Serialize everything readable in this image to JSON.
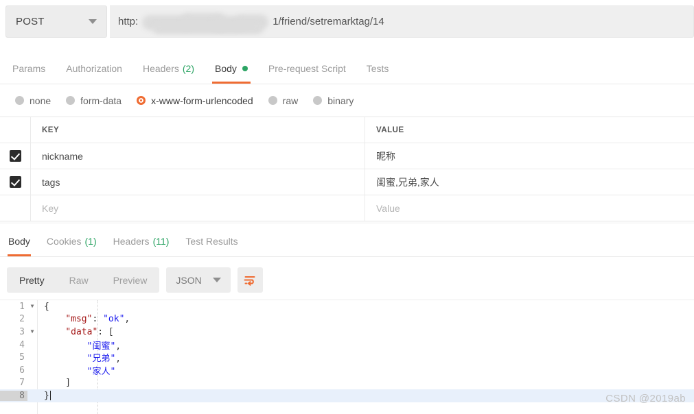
{
  "request": {
    "method": "POST",
    "method_caret": "chevron-down-icon",
    "url_scheme": "http:",
    "url_redacted": true,
    "url_tail": "1/friend/setremarktag/14",
    "tabs": [
      {
        "label": "Params",
        "count": null,
        "active": false,
        "dot": false
      },
      {
        "label": "Authorization",
        "count": null,
        "active": false,
        "dot": false
      },
      {
        "label": "Headers",
        "count": "(2)",
        "active": false,
        "dot": false
      },
      {
        "label": "Body",
        "count": null,
        "active": true,
        "dot": true
      },
      {
        "label": "Pre-request Script",
        "count": null,
        "active": false,
        "dot": false
      },
      {
        "label": "Tests",
        "count": null,
        "active": false,
        "dot": false
      }
    ],
    "body_types": [
      {
        "label": "none",
        "selected": false
      },
      {
        "label": "form-data",
        "selected": false
      },
      {
        "label": "x-www-form-urlencoded",
        "selected": true
      },
      {
        "label": "raw",
        "selected": false
      },
      {
        "label": "binary",
        "selected": false
      }
    ],
    "table": {
      "columns": [
        "KEY",
        "VALUE"
      ],
      "rows": [
        {
          "checked": true,
          "key": "nickname",
          "value": "昵称",
          "placeholder": false
        },
        {
          "checked": true,
          "key": "tags",
          "value": "闺蜜,兄弟,家人",
          "placeholder": false
        },
        {
          "checked": false,
          "key": "Key",
          "value": "Value",
          "placeholder": true
        }
      ]
    }
  },
  "response": {
    "tabs": [
      {
        "label": "Body",
        "count": null,
        "active": true
      },
      {
        "label": "Cookies",
        "count": "(1)",
        "active": false
      },
      {
        "label": "Headers",
        "count": "(11)",
        "active": false
      },
      {
        "label": "Test Results",
        "count": null,
        "active": false
      }
    ],
    "view_modes": [
      {
        "label": "Pretty",
        "active": true
      },
      {
        "label": "Raw",
        "active": false
      },
      {
        "label": "Preview",
        "active": false
      }
    ],
    "format": "JSON",
    "wrap_icon": "word-wrap-icon",
    "code_lines": [
      {
        "num": "1",
        "fold": true,
        "active": false,
        "tokens": [
          {
            "t": "punc",
            "v": "{"
          }
        ]
      },
      {
        "num": "2",
        "fold": false,
        "active": false,
        "tokens": [
          {
            "t": "punc",
            "v": "    "
          },
          {
            "t": "key",
            "v": "\"msg\""
          },
          {
            "t": "punc",
            "v": ": "
          },
          {
            "t": "str",
            "v": "\"ok\""
          },
          {
            "t": "punc",
            "v": ","
          }
        ]
      },
      {
        "num": "3",
        "fold": true,
        "active": false,
        "tokens": [
          {
            "t": "punc",
            "v": "    "
          },
          {
            "t": "key",
            "v": "\"data\""
          },
          {
            "t": "punc",
            "v": ": ["
          }
        ]
      },
      {
        "num": "4",
        "fold": false,
        "active": false,
        "tokens": [
          {
            "t": "punc",
            "v": "        "
          },
          {
            "t": "str",
            "v": "\"闺蜜\""
          },
          {
            "t": "punc",
            "v": ","
          }
        ]
      },
      {
        "num": "5",
        "fold": false,
        "active": false,
        "tokens": [
          {
            "t": "punc",
            "v": "        "
          },
          {
            "t": "str",
            "v": "\"兄弟\""
          },
          {
            "t": "punc",
            "v": ","
          }
        ]
      },
      {
        "num": "6",
        "fold": false,
        "active": false,
        "tokens": [
          {
            "t": "punc",
            "v": "        "
          },
          {
            "t": "str",
            "v": "\"家人\""
          }
        ]
      },
      {
        "num": "7",
        "fold": false,
        "active": false,
        "tokens": [
          {
            "t": "punc",
            "v": "    ]"
          }
        ]
      },
      {
        "num": "8",
        "fold": false,
        "active": true,
        "tokens": [
          {
            "t": "punc",
            "v": "}"
          }
        ],
        "caret": true
      }
    ]
  },
  "watermark": "CSDN @2019ab",
  "colors": {
    "accent_orange": "#ef6c33",
    "green": "#2ca464",
    "json_key": "#a31515",
    "json_string": "#1a1aee",
    "active_line": "#e8f0fb"
  }
}
